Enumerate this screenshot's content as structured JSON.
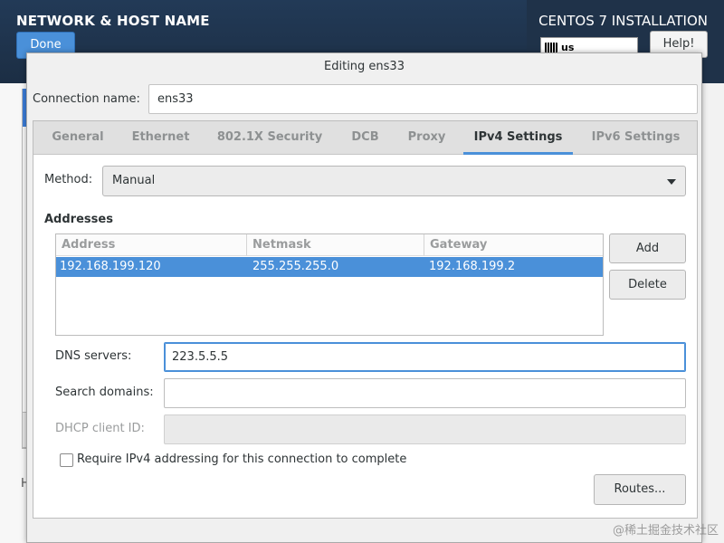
{
  "header": {
    "title": "NETWORK & HOST NAME",
    "done_label": "Done",
    "install_title": "CENTOS 7 INSTALLATION",
    "keyboard_layout": "us",
    "help_label": "Help!"
  },
  "background": {
    "partial_letter": "H"
  },
  "dialog": {
    "title": "Editing ens33",
    "connection_name_label": "Connection name:",
    "connection_name_value": "ens33",
    "tabs": [
      {
        "label": "General",
        "active": false
      },
      {
        "label": "Ethernet",
        "active": false
      },
      {
        "label": "802.1X Security",
        "active": false
      },
      {
        "label": "DCB",
        "active": false
      },
      {
        "label": "Proxy",
        "active": false
      },
      {
        "label": "IPv4 Settings",
        "active": true
      },
      {
        "label": "IPv6 Settings",
        "active": false
      }
    ],
    "ipv4": {
      "method_label": "Method:",
      "method_value": "Manual",
      "addresses_title": "Addresses",
      "columns": [
        "Address",
        "Netmask",
        "Gateway"
      ],
      "rows": [
        {
          "address": "192.168.199.120",
          "netmask": "255.255.255.0",
          "gateway": "192.168.199.2"
        }
      ],
      "add_label": "Add",
      "delete_label": "Delete",
      "dns_label": "DNS servers:",
      "dns_value": "223.5.5.5",
      "search_label": "Search domains:",
      "search_value": "",
      "dhcp_label": "DHCP client ID:",
      "dhcp_value": "",
      "require_label": "Require IPv4 addressing for this connection to complete",
      "require_checked": false,
      "routes_label": "Routes..."
    }
  },
  "watermark": "@稀土掘金技术社区",
  "colors": {
    "accent": "#4a90d9",
    "header_bg": "#223a57"
  }
}
